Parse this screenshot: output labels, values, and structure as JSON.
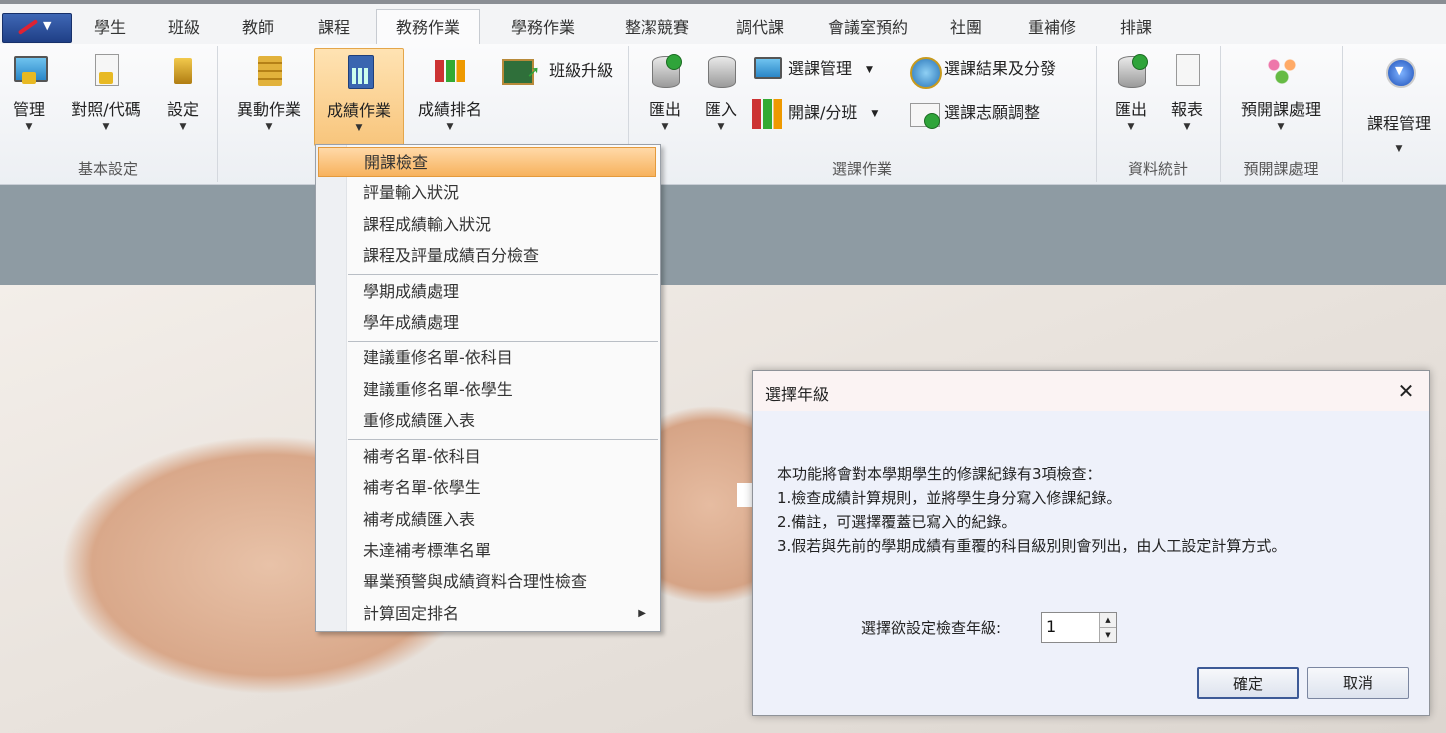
{
  "tabs": [
    "學生",
    "班級",
    "教師",
    "課程",
    "教務作業",
    "學務作業",
    "整潔競賽",
    "調代課",
    "會議室預約",
    "社團",
    "重補修",
    "排課"
  ],
  "active_tab": "教務作業",
  "ribbon": {
    "groups": {
      "basic": "基本設定",
      "course_selection": "選課作業",
      "stats": "資料統計",
      "pre_course": "預開課處理"
    },
    "buttons": {
      "manage": "管理",
      "mapping": "對照/代碼",
      "settings": "設定",
      "change_ops": "異動作業",
      "grade_ops": "成績作業",
      "grade_rank": "成績排名",
      "class_promote": "班級升級",
      "export": "匯出",
      "import": "匯入",
      "course_select_mgmt": "選課管理",
      "open_class": "開課/分班",
      "result_distribute": "選課結果及分發",
      "preference_adjust": "選課志願調整",
      "stats_export": "匯出",
      "report": "報表",
      "pre_course_btn": "預開課處理",
      "course_mgmt": "課程管理"
    }
  },
  "menu": {
    "items": [
      "開課檢查",
      "評量輸入狀況",
      "課程成績輸入狀況",
      "課程及評量成績百分檢查",
      "學期成績處理",
      "學年成績處理",
      "建議重修名單-依科目",
      "建議重修名單-依學生",
      "重修成績匯入表",
      "補考名單-依科目",
      "補考名單-依學生",
      "補考成績匯入表",
      "未達補考標準名單",
      "畢業預警與成績資料合理性檢查",
      "計算固定排名"
    ],
    "highlighted": "開課檢查"
  },
  "dialog": {
    "title": "選擇年級",
    "lines": [
      "本功能將會對本學期學生的修課紀錄有3項檢查：",
      "1.檢查成績計算規則，並將學生身分寫入修課紀錄。",
      "2.備註，可選擇覆蓋已寫入的紀錄。",
      "3.假若與先前的學期成績有重覆的科目級別則會列出，由人工設定計算方式。"
    ],
    "grade_label": "選擇欲設定檢查年級:",
    "grade_value": "1",
    "ok_label": "確定",
    "cancel_label": "取消"
  }
}
